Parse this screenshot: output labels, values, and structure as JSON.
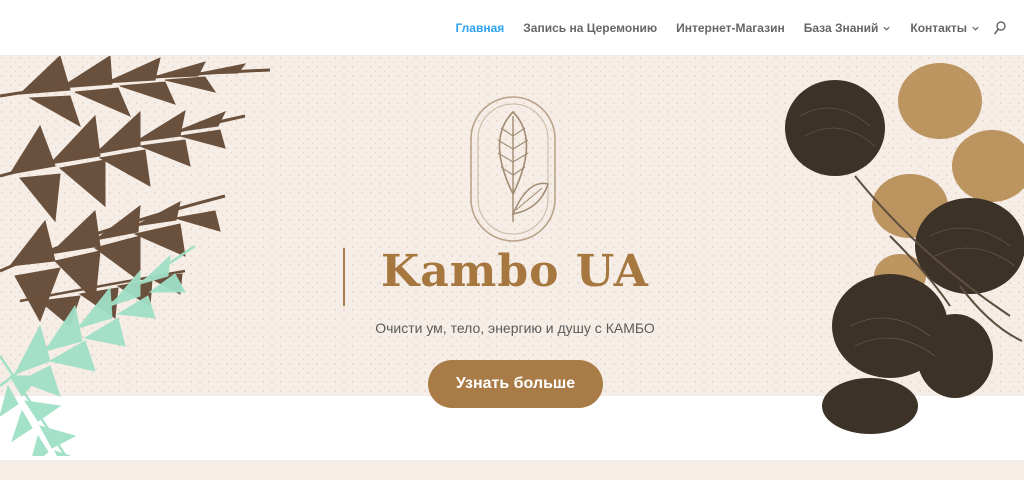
{
  "nav": {
    "items": [
      {
        "label": "Главная",
        "active": true,
        "dropdown": false
      },
      {
        "label": "Запись на Церемонию",
        "active": false,
        "dropdown": false
      },
      {
        "label": "Интернет-Магазин",
        "active": false,
        "dropdown": false
      },
      {
        "label": "База Знаний",
        "active": false,
        "dropdown": true
      },
      {
        "label": "Контакты",
        "active": false,
        "dropdown": true
      }
    ],
    "search_icon": "search-icon"
  },
  "hero": {
    "title": "Kambo UA",
    "tagline": "Очисти ум, тело, энергию и душу с КАМБО",
    "cta_label": "Узнать больше"
  },
  "colors": {
    "accent": "#a97c47",
    "hero_bg": "#f6ede6",
    "nav_active": "#2ea3f2",
    "nav_text": "#666666",
    "fern_dark": "#6a513d",
    "fern_light": "#9fe0c6"
  }
}
